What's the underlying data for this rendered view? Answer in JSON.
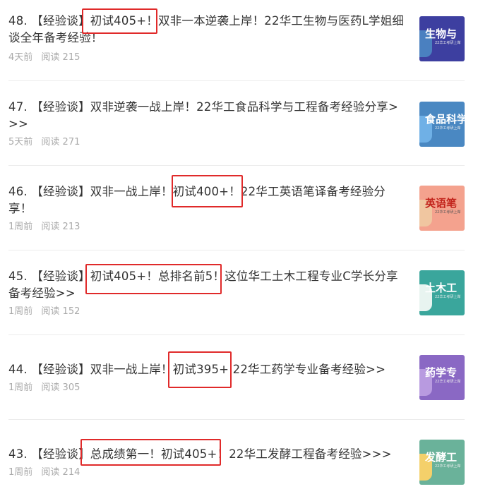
{
  "articles": [
    {
      "title": "48. 【经验谈】初试405+！双非一本逆袭上岸！22华工生物与医药L学姐细谈全年备考经验！",
      "time": "4天前",
      "reads": "阅读 215",
      "highlight": "初试405+！",
      "thumb": {
        "label": "生物与",
        "sub": "22华工考研上岸",
        "bg": "#3d3fa0",
        "text_color": "#ffffff",
        "figure": "#4a80c0",
        "accent": "#d8d8f0"
      }
    },
    {
      "title": "47. 【经验谈】双非逆袭一战上岸！22华工食品科学与工程备考经验分享>>>",
      "time": "5天前",
      "reads": "阅读 271",
      "highlight": "",
      "thumb": {
        "label": "食品科学",
        "sub": "22华工考研上岸",
        "bg": "#4a88c2",
        "text_color": "#ffffff",
        "figure": "#6fb0e6",
        "accent": "#dfe9f5"
      }
    },
    {
      "title": "46. 【经验谈】双非一战上岸！初试400+！22华工英语笔译备考经验分享！",
      "time": "1周前",
      "reads": "阅读 213",
      "highlight": "初试400+！",
      "thumb": {
        "label": "英语笔",
        "sub": "22华工考研上岸",
        "bg": "#f4a28e",
        "text_color": "#c2241c",
        "figure": "#f0c6a0",
        "accent": "#f6cfc2"
      }
    },
    {
      "title": "45. 【经验谈】初试405+！总排名前5！这位华工土木工程专业C学长分享备考经验>>",
      "time": "1周前",
      "reads": "阅读 152",
      "highlight": "初试405+！总排名前5！",
      "thumb": {
        "label": "土木工",
        "sub": "22华工考研上岸",
        "bg": "#3aa69c",
        "text_color": "#ffffff",
        "figure": "#e8f4f0",
        "accent": "#c7e6e2"
      }
    },
    {
      "title": "44. 【经验谈】双非一战上岸！初试395+ 22华工药学专业备考经验>>",
      "time": "1周前",
      "reads": "阅读 305",
      "highlight": "初试395+",
      "thumb": {
        "label": "药学专",
        "sub": "22华工考研上岸",
        "bg": "#8a68c4",
        "text_color": "#ffffff",
        "figure": "#b89ae0",
        "accent": "#e3d8f3"
      }
    },
    {
      "title": "43. 【经验谈】总成绩第一！初试405+！22华工发酵工程备考经验>>>",
      "time": "1周前",
      "reads": "阅读 214",
      "highlight": "总成绩第一！初试405+！",
      "thumb": {
        "label": "发酵工",
        "sub": "22华工考研上岸",
        "bg": "#6ab29a",
        "text_color": "#ffffff",
        "figure": "#f4d06a",
        "accent": "#d3ebe2"
      }
    }
  ],
  "highlight_color": "#e02a2a"
}
